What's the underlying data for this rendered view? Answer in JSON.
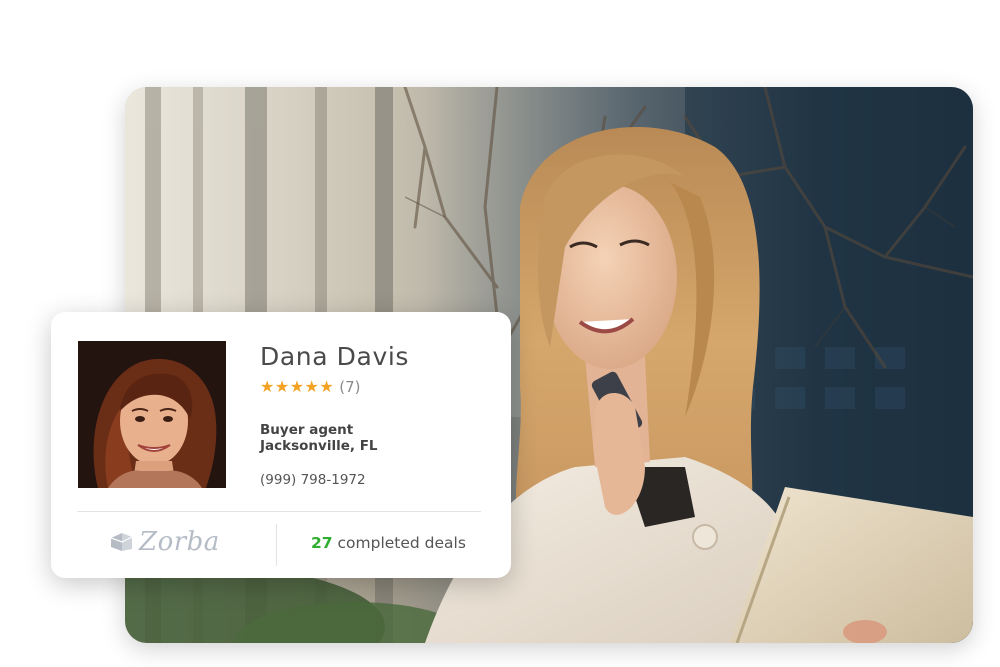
{
  "agent": {
    "name": "Dana Davis",
    "stars": "★★★★★",
    "review_count": "(7)",
    "role": "Buyer agent",
    "location": "Jacksonville, FL",
    "phone": "(999) 798-1972",
    "deals_count": "27",
    "deals_label": "completed deals"
  },
  "brand": {
    "logo_text": "Zorba"
  },
  "colors": {
    "star": "#f3a224",
    "deals_count": "#2fae2f",
    "logo": "#b5bcc6"
  },
  "icons": {
    "logo_mark": "zorba-logo-icon",
    "rating": "star-icon"
  }
}
